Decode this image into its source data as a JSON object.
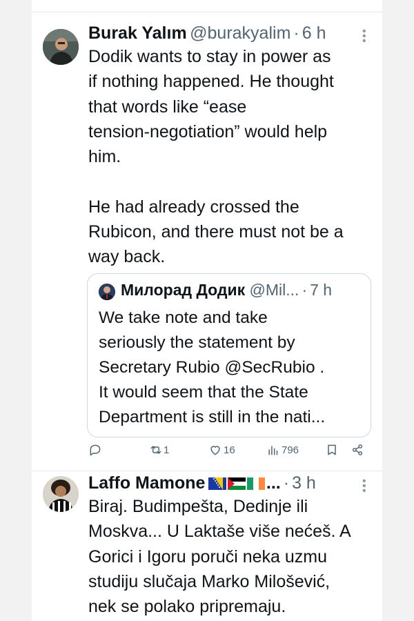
{
  "tweet1": {
    "name": "Burak Yalım",
    "handle": "@burakyalim",
    "dot": "·",
    "time": "6 h",
    "lines": [
      "Dodik wants to stay in power as",
      "if nothing happened. He thought",
      "that words like “ease",
      "tension-negotiation” would help",
      "him.",
      "",
      "He had already crossed the",
      "Rubicon, and there must not be a",
      "way back."
    ],
    "quote": {
      "name": "Милорад Додик",
      "handle": "@Mil...",
      "dot": "·",
      "time": "7 h",
      "lines": [
        "We take note and take",
        "seriously the statement by",
        "Secretary Rubio @SecRubio .",
        "It would seem that the State",
        "Department is still in the nati..."
      ]
    },
    "actions": {
      "reply_count": "",
      "retweet_count": "1",
      "like_count": "16",
      "views_count": "796"
    }
  },
  "tweet2": {
    "name": "Laffo Mamone",
    "name_suffix": "...",
    "dot": "·",
    "time": "3 h",
    "flags": [
      "bosnia-flag",
      "palestine-flag",
      "ireland-flag"
    ],
    "lines": [
      "Biraj. Budimpešta, Dedinje ili",
      "Moskva... U Laktaše više nećeš. A",
      "Gorici i Igoru poruči neka uzmu",
      "studiju slučaja Marko Milošević,",
      "nek se polako pripremaju."
    ]
  },
  "colors": {
    "text": "#0f1419",
    "muted": "#536471",
    "border": "#cfd9de",
    "divider": "#e6e9ec"
  }
}
